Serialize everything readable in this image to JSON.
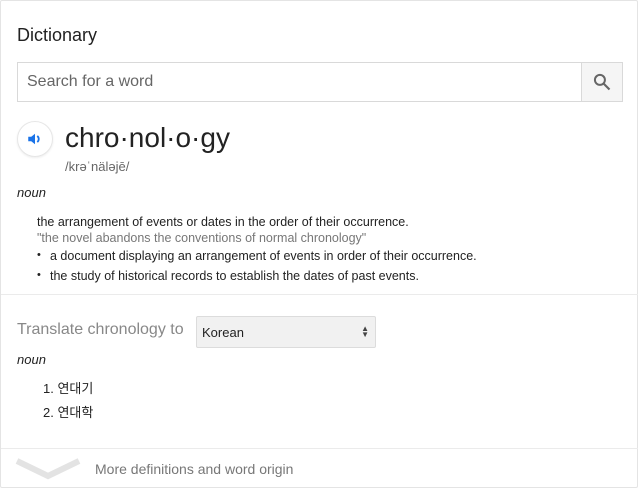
{
  "title": "Dictionary",
  "search": {
    "placeholder": "Search for a word",
    "value": ""
  },
  "entry": {
    "word": "chro·nol·o·gy",
    "phonetic": "/krəˈnäləjē/",
    "part_of_speech": "noun",
    "definition": "the arrangement of events or dates in the order of their occurrence.",
    "example": "\"the novel abandons the conventions of normal chronology\"",
    "sub_definitions": [
      "a document displaying an arrangement of events in order of their occurrence.",
      "the study of historical records to establish the dates of past events."
    ]
  },
  "translate": {
    "label": "Translate chronology to",
    "language": "Korean",
    "part_of_speech": "noun",
    "items": [
      "1. 연대기",
      "2. 연대학"
    ]
  },
  "more_label": "More definitions and word origin",
  "colors": {
    "accent": "#1a73e8"
  }
}
